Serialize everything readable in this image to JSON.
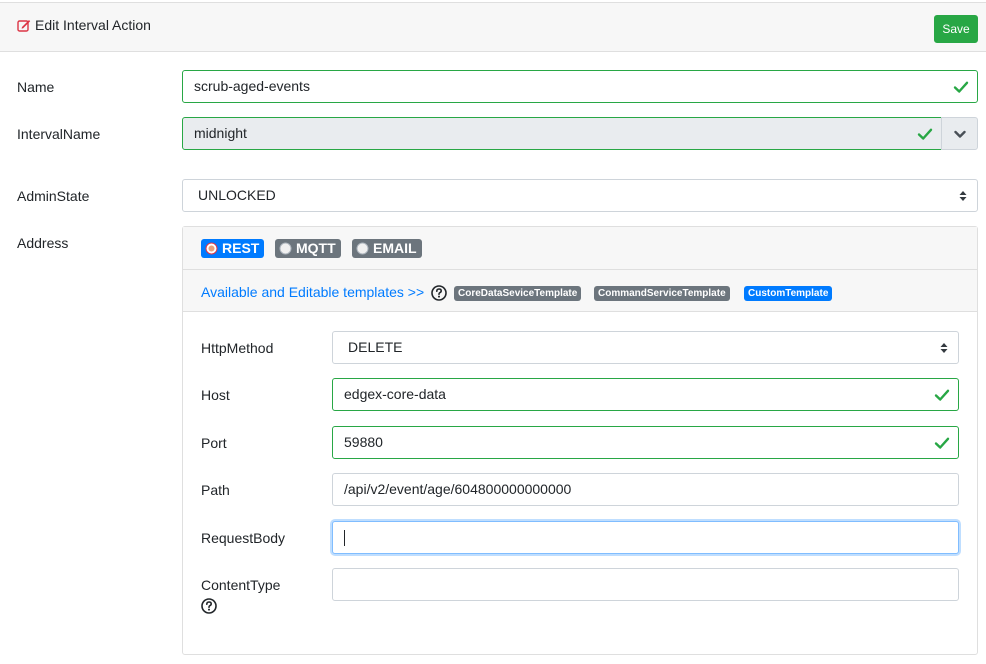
{
  "header": {
    "title": "Edit Interval Action",
    "save_label": "Save"
  },
  "form": {
    "name": {
      "label": "Name",
      "value": "scrub-aged-events"
    },
    "interval_name": {
      "label": "IntervalName",
      "value": "midnight"
    },
    "admin_state": {
      "label": "AdminState",
      "value": "UNLOCKED"
    },
    "address": {
      "label": "Address"
    }
  },
  "protocols": [
    {
      "label": "REST",
      "selected": true
    },
    {
      "label": "MQTT",
      "selected": false
    },
    {
      "label": "EMAIL",
      "selected": false
    }
  ],
  "templates": {
    "link_text": "Available and Editable templates >>",
    "items": [
      "CoreDataSeviceTemplate",
      "CommandServiceTemplate",
      "CustomTemplate"
    ]
  },
  "rest": {
    "http_method": {
      "label": "HttpMethod",
      "value": "DELETE"
    },
    "host": {
      "label": "Host",
      "value": "edgex-core-data"
    },
    "port": {
      "label": "Port",
      "value": "59880"
    },
    "path": {
      "label": "Path",
      "value": "/api/v2/event/age/604800000000000"
    },
    "request_body": {
      "label": "RequestBody",
      "value": ""
    },
    "content_type": {
      "label": "ContentType",
      "value": ""
    }
  },
  "colors": {
    "success": "#28a745",
    "primary": "#007bff",
    "secondary": "#6c757d",
    "danger": "#dc3545"
  },
  "icons": {
    "title": "edit-icon",
    "valid": "check-icon",
    "help": "question-circle-icon",
    "append": "chevron-down-icon"
  }
}
